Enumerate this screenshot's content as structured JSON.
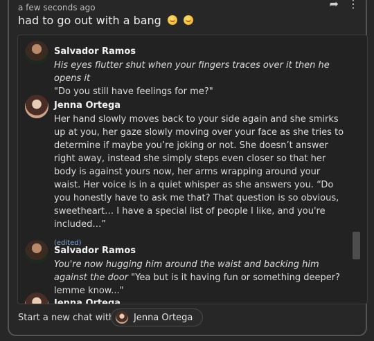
{
  "header": {
    "timestamp": "a few seconds ago",
    "message": "had to go out with a bang"
  },
  "icons": {
    "share": "share-icon",
    "more": "more-vert-icon"
  },
  "messages": [
    {
      "author": "Salvador Ramos",
      "avatar": "avatar-salvador",
      "italic": "His eyes flutter shut when your fingers traces over it then he opens it",
      "text": "\"Do you still have feelings for me?\""
    },
    {
      "author": "Jenna Ortega",
      "avatar": "avatar-jenna",
      "text": "Her hand slowly moves back to your side again and she smirks up at you, her gaze slowly moving over your face as she tries to determine if maybe you’re joking or not. She doesn’t answer right away, instead she simply steps even closer so that her body is against yours now, her arms wrapping around your waist. Her voice is in a quiet whisper as she answers you. “Do you honestly have to ask me that? That question is so obvious, sweetheart… I have a special list of people I like, and you're included…”",
      "edited": "(edited)"
    },
    {
      "author": "Salvador Ramos",
      "avatar": "avatar-salvador",
      "italic": "You're now hugging him around the waist and backing him against the door",
      "text": "\"Yea but is it having fun or something deeper? lemme know...\""
    },
    {
      "author": "Jenna Ortega",
      "avatar": "avatar-jenna"
    }
  ],
  "footer": {
    "label": "Start a new chat with",
    "chip_label": "Jenna Ortega"
  }
}
